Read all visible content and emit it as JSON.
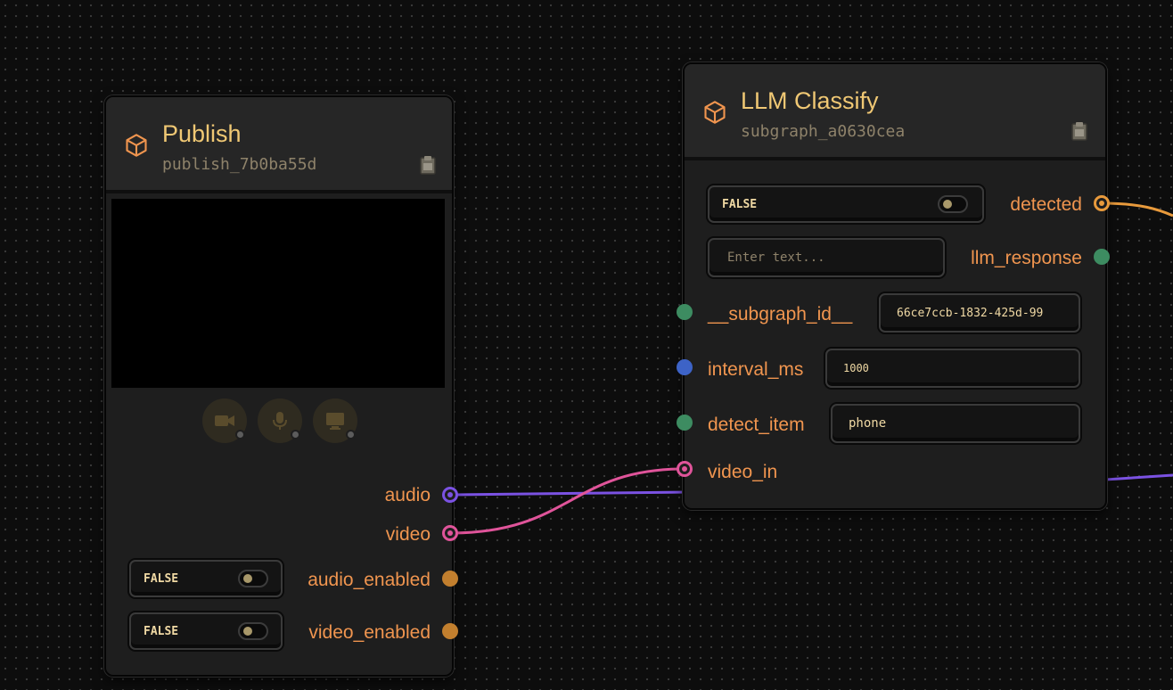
{
  "colors": {
    "audio_wire": "#7b52e3",
    "video_wire": "#e0549a",
    "bool_port": "#c27f2e",
    "text_port": "#3d8c61",
    "number_port": "#3d63c7",
    "label": "#f0954f",
    "title": "#f0c874"
  },
  "publish_node": {
    "title": "Publish",
    "id": "publish_7b0ba55d",
    "icon": "cube-icon",
    "media_buttons": [
      {
        "name": "camera-icon"
      },
      {
        "name": "microphone-icon"
      },
      {
        "name": "screen-share-icon"
      }
    ],
    "outputs": {
      "audio": "audio",
      "video": "video",
      "audio_enabled": "audio_enabled",
      "video_enabled": "video_enabled"
    },
    "audio_enabled_toggle": "FALSE",
    "video_enabled_toggle": "FALSE"
  },
  "llm_node": {
    "title": "LLM Classify",
    "id": "subgraph_a0630cea",
    "icon": "cube-icon",
    "detected_toggle": "FALSE",
    "outputs": {
      "detected": "detected",
      "llm_response": "llm_response"
    },
    "llm_response_placeholder": "Enter text...",
    "inputs": {
      "subgraph_id": "__subgraph_id__",
      "interval_ms": "interval_ms",
      "detect_item": "detect_item",
      "video_in": "video_in"
    },
    "values": {
      "subgraph_id": "66ce7ccb-1832-425d-99",
      "interval_ms": "1000",
      "detect_item": "phone"
    }
  }
}
